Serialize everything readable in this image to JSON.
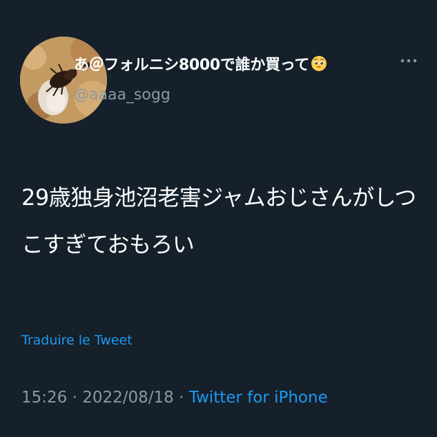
{
  "user": {
    "display_name": "あ＠フォルニシ8000で誰か買って",
    "handle": "@aaaa_sogg",
    "avatar_icon": "beetle-avatar-icon",
    "name_emoji": "pleading-face-emoji"
  },
  "more_icon": "more-options-icon",
  "tweet": {
    "text": "29歳独身池沼老害ジャムおじさんがしつこすぎておもろい"
  },
  "translate_label": "Traduire le Tweet",
  "meta": {
    "time": "15:26",
    "separator": "·",
    "date": "2022/08/18",
    "source": "Twitter for iPhone"
  },
  "colors": {
    "background": "#15202b",
    "text": "#ffffff",
    "secondary": "#8b98a5",
    "link": "#1d9bf0"
  }
}
